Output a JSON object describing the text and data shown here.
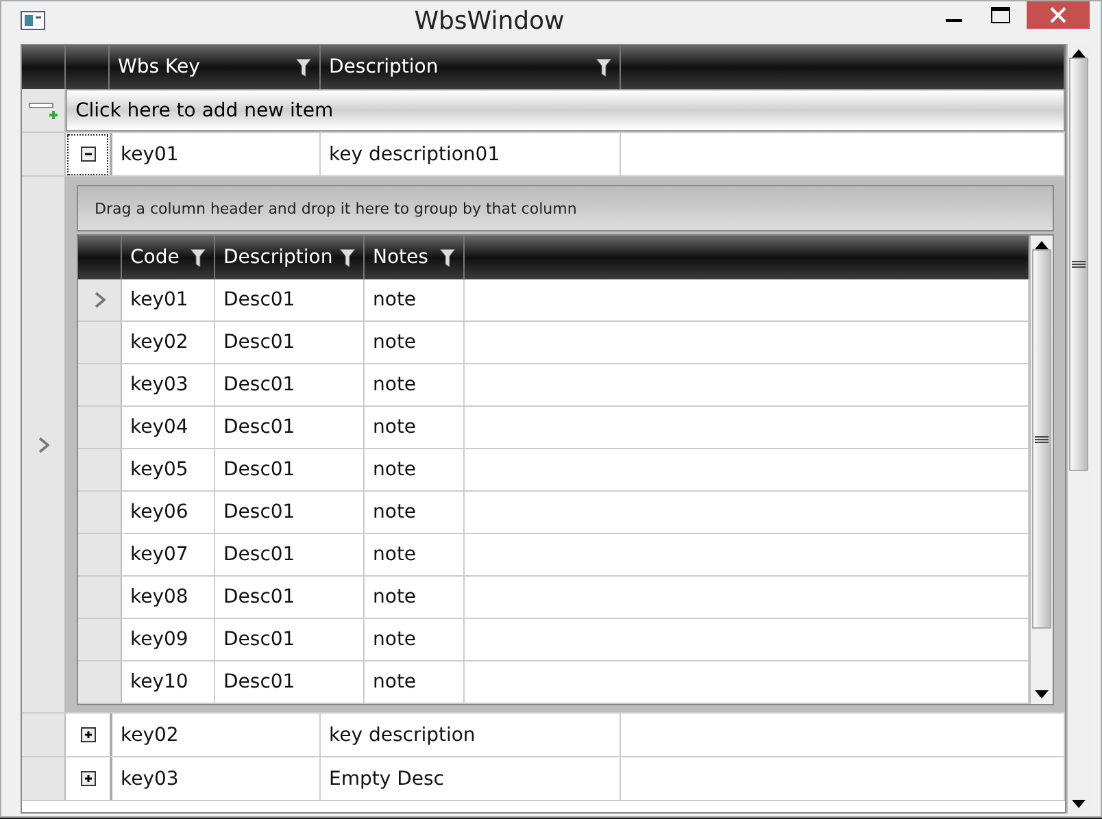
{
  "window": {
    "title": "WbsWindow"
  },
  "grid": {
    "columns": [
      "Wbs Key",
      "Description"
    ],
    "add_new_label": "Click here to add new item",
    "rows": [
      {
        "key": "key01",
        "description": "key description01",
        "expanded": true,
        "current": true,
        "detail": {
          "group_panel_hint": "Drag a column header and drop it here to group by that column",
          "columns": [
            "Code",
            "Description",
            "Notes"
          ],
          "rows": [
            {
              "code": "key01",
              "description": "Desc01",
              "notes": "note",
              "current": true
            },
            {
              "code": "key02",
              "description": "Desc01",
              "notes": "note",
              "current": false
            },
            {
              "code": "key03",
              "description": "Desc01",
              "notes": "note",
              "current": false
            },
            {
              "code": "key04",
              "description": "Desc01",
              "notes": "note",
              "current": false
            },
            {
              "code": "key05",
              "description": "Desc01",
              "notes": "note",
              "current": false
            },
            {
              "code": "key06",
              "description": "Desc01",
              "notes": "note",
              "current": false
            },
            {
              "code": "key07",
              "description": "Desc01",
              "notes": "note",
              "current": false
            },
            {
              "code": "key08",
              "description": "Desc01",
              "notes": "note",
              "current": false
            },
            {
              "code": "key09",
              "description": "Desc01",
              "notes": "note",
              "current": false
            },
            {
              "code": "key10",
              "description": "Desc01",
              "notes": "note",
              "current": false
            }
          ]
        }
      },
      {
        "key": "key02",
        "description": "key description",
        "expanded": false,
        "current": false
      },
      {
        "key": "key03",
        "description": "Empty Desc",
        "expanded": false,
        "current": false
      }
    ]
  }
}
